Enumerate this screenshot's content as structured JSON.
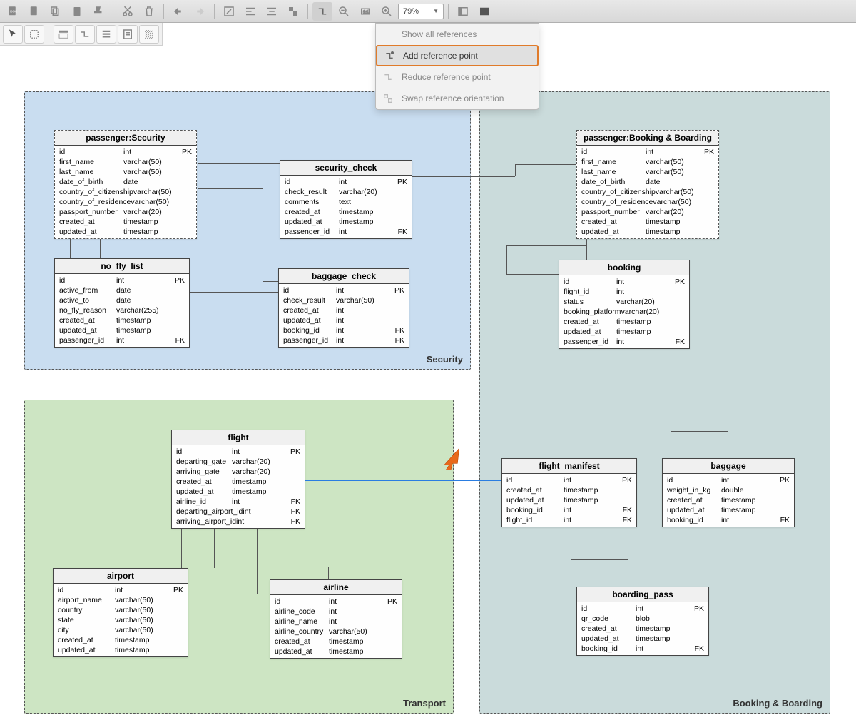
{
  "toolbar": {
    "zoom": "79%",
    "menu": {
      "show_all": "Show all references",
      "add_ref": "Add reference point",
      "reduce_ref": "Reduce reference point",
      "swap_ref": "Swap reference orientation"
    }
  },
  "regions": {
    "security": {
      "label": "Security"
    },
    "transport": {
      "label": "Transport"
    },
    "booking": {
      "label": "Booking & Boarding"
    }
  },
  "entities": {
    "passenger_security": {
      "title": "passenger:Security",
      "cols": [
        {
          "n": "id",
          "t": "int",
          "k": "PK"
        },
        {
          "n": "first_name",
          "t": "varchar(50)",
          "k": ""
        },
        {
          "n": "last_name",
          "t": "varchar(50)",
          "k": ""
        },
        {
          "n": "date_of_birth",
          "t": "date",
          "k": ""
        },
        {
          "n": "country_of_citizenship",
          "t": "varchar(50)",
          "k": ""
        },
        {
          "n": "country_of_residence",
          "t": "varchar(50)",
          "k": ""
        },
        {
          "n": "passport_number",
          "t": "varchar(20)",
          "k": ""
        },
        {
          "n": "created_at",
          "t": "timestamp",
          "k": ""
        },
        {
          "n": "updated_at",
          "t": "timestamp",
          "k": ""
        }
      ]
    },
    "security_check": {
      "title": "security_check",
      "cols": [
        {
          "n": "id",
          "t": "int",
          "k": "PK"
        },
        {
          "n": "check_result",
          "t": "varchar(20)",
          "k": ""
        },
        {
          "n": "comments",
          "t": "text",
          "k": ""
        },
        {
          "n": "created_at",
          "t": "timestamp",
          "k": ""
        },
        {
          "n": "updated_at",
          "t": "timestamp",
          "k": ""
        },
        {
          "n": "passenger_id",
          "t": "int",
          "k": "FK"
        }
      ]
    },
    "no_fly_list": {
      "title": "no_fly_list",
      "cols": [
        {
          "n": "id",
          "t": "int",
          "k": "PK"
        },
        {
          "n": "active_from",
          "t": "date",
          "k": ""
        },
        {
          "n": "active_to",
          "t": "date",
          "k": ""
        },
        {
          "n": "no_fly_reason",
          "t": "varchar(255)",
          "k": ""
        },
        {
          "n": "created_at",
          "t": "timestamp",
          "k": ""
        },
        {
          "n": "updated_at",
          "t": "timestamp",
          "k": ""
        },
        {
          "n": "passenger_id",
          "t": "int",
          "k": "FK"
        }
      ]
    },
    "baggage_check": {
      "title": "baggage_check",
      "cols": [
        {
          "n": "id",
          "t": "int",
          "k": "PK"
        },
        {
          "n": "check_result",
          "t": "varchar(50)",
          "k": ""
        },
        {
          "n": "created_at",
          "t": "int",
          "k": ""
        },
        {
          "n": "updated_at",
          "t": "int",
          "k": ""
        },
        {
          "n": "booking_id",
          "t": "int",
          "k": "FK"
        },
        {
          "n": "passenger_id",
          "t": "int",
          "k": "FK"
        }
      ]
    },
    "passenger_booking": {
      "title": "passenger:Booking & Boarding",
      "cols": [
        {
          "n": "id",
          "t": "int",
          "k": "PK"
        },
        {
          "n": "first_name",
          "t": "varchar(50)",
          "k": ""
        },
        {
          "n": "last_name",
          "t": "varchar(50)",
          "k": ""
        },
        {
          "n": "date_of_birth",
          "t": "date",
          "k": ""
        },
        {
          "n": "country_of_citizenship",
          "t": "varchar(50)",
          "k": ""
        },
        {
          "n": "country_of_residence",
          "t": "varchar(50)",
          "k": ""
        },
        {
          "n": "passport_number",
          "t": "varchar(20)",
          "k": ""
        },
        {
          "n": "created_at",
          "t": "timestamp",
          "k": ""
        },
        {
          "n": "updated_at",
          "t": "timestamp",
          "k": ""
        }
      ]
    },
    "booking": {
      "title": "booking",
      "cols": [
        {
          "n": "id",
          "t": "int",
          "k": "PK"
        },
        {
          "n": "flight_id",
          "t": "int",
          "k": ""
        },
        {
          "n": "status",
          "t": "varchar(20)",
          "k": ""
        },
        {
          "n": "booking_platform",
          "t": "varchar(20)",
          "k": ""
        },
        {
          "n": "created_at",
          "t": "timestamp",
          "k": ""
        },
        {
          "n": "updated_at",
          "t": "timestamp",
          "k": ""
        },
        {
          "n": "passenger_id",
          "t": "int",
          "k": "FK"
        }
      ]
    },
    "flight_manifest": {
      "title": "flight_manifest",
      "cols": [
        {
          "n": "id",
          "t": "int",
          "k": "PK"
        },
        {
          "n": "created_at",
          "t": "timestamp",
          "k": ""
        },
        {
          "n": "updated_at",
          "t": "timestamp",
          "k": ""
        },
        {
          "n": "booking_id",
          "t": "int",
          "k": "FK"
        },
        {
          "n": "flight_id",
          "t": "int",
          "k": "FK"
        }
      ]
    },
    "baggage": {
      "title": "baggage",
      "cols": [
        {
          "n": "id",
          "t": "int",
          "k": "PK"
        },
        {
          "n": "weight_in_kg",
          "t": "double",
          "k": ""
        },
        {
          "n": "created_at",
          "t": "timestamp",
          "k": ""
        },
        {
          "n": "updated_at",
          "t": "timestamp",
          "k": ""
        },
        {
          "n": "booking_id",
          "t": "int",
          "k": "FK"
        }
      ]
    },
    "boarding_pass": {
      "title": "boarding_pass",
      "cols": [
        {
          "n": "id",
          "t": "int",
          "k": "PK"
        },
        {
          "n": "qr_code",
          "t": "blob",
          "k": ""
        },
        {
          "n": "created_at",
          "t": "timestamp",
          "k": ""
        },
        {
          "n": "updated_at",
          "t": "timestamp",
          "k": ""
        },
        {
          "n": "booking_id",
          "t": "int",
          "k": "FK"
        }
      ]
    },
    "flight": {
      "title": "flight",
      "cols": [
        {
          "n": "id",
          "t": "int",
          "k": "PK"
        },
        {
          "n": "departing_gate",
          "t": "varchar(20)",
          "k": ""
        },
        {
          "n": "arriving_gate",
          "t": "varchar(20)",
          "k": ""
        },
        {
          "n": "created_at",
          "t": "timestamp",
          "k": ""
        },
        {
          "n": "updated_at",
          "t": "timestamp",
          "k": ""
        },
        {
          "n": "airline_id",
          "t": "int",
          "k": "FK"
        },
        {
          "n": "departing_airport_id",
          "t": "int",
          "k": "FK"
        },
        {
          "n": "arriving_airport_id",
          "t": "int",
          "k": "FK"
        }
      ]
    },
    "airport": {
      "title": "airport",
      "cols": [
        {
          "n": "id",
          "t": "int",
          "k": "PK"
        },
        {
          "n": "airport_name",
          "t": "varchar(50)",
          "k": ""
        },
        {
          "n": "country",
          "t": "varchar(50)",
          "k": ""
        },
        {
          "n": "state",
          "t": "varchar(50)",
          "k": ""
        },
        {
          "n": "city",
          "t": "varchar(50)",
          "k": ""
        },
        {
          "n": "created_at",
          "t": "timestamp",
          "k": ""
        },
        {
          "n": "updated_at",
          "t": "timestamp",
          "k": ""
        }
      ]
    },
    "airline": {
      "title": "airline",
      "cols": [
        {
          "n": "id",
          "t": "int",
          "k": "PK"
        },
        {
          "n": "airline_code",
          "t": "int",
          "k": ""
        },
        {
          "n": "airline_name",
          "t": "int",
          "k": ""
        },
        {
          "n": "airline_country",
          "t": "varchar(50)",
          "k": ""
        },
        {
          "n": "created_at",
          "t": "timestamp",
          "k": ""
        },
        {
          "n": "updated_at",
          "t": "timestamp",
          "k": ""
        }
      ]
    }
  }
}
